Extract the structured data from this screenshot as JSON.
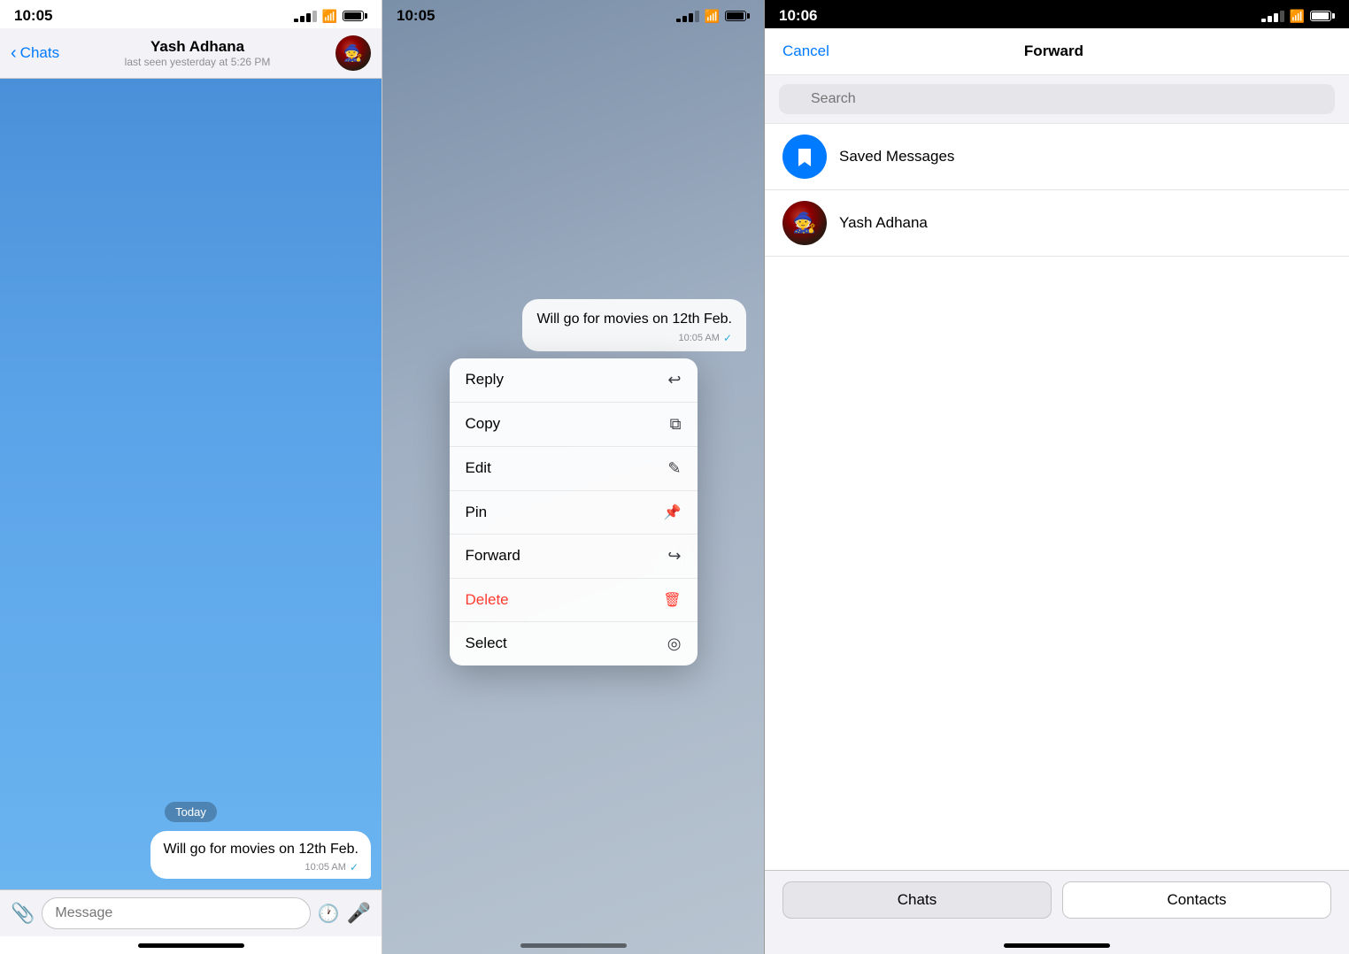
{
  "panel1": {
    "status_time": "10:05",
    "nav_back_label": "Chats",
    "contact_name": "Yash Adhana",
    "contact_status": "last seen yesterday at 5:26 PM",
    "date_badge": "Today",
    "message_text": "Will go for movies on 12th Feb.",
    "message_time": "10:05 AM",
    "input_placeholder": "Message"
  },
  "panel2": {
    "status_time": "10:05",
    "message_text": "Will go for movies on 12th Feb.",
    "message_time": "10:05 AM",
    "menu_items": [
      {
        "label": "Reply",
        "icon": "↩",
        "type": "normal"
      },
      {
        "label": "Copy",
        "icon": "⧉",
        "type": "normal"
      },
      {
        "label": "Edit",
        "icon": "✎",
        "type": "normal"
      },
      {
        "label": "Pin",
        "icon": "📌",
        "type": "normal"
      },
      {
        "label": "Forward",
        "icon": "↪",
        "type": "normal"
      },
      {
        "label": "Delete",
        "icon": "🗑",
        "type": "delete"
      },
      {
        "label": "Select",
        "icon": "◎",
        "type": "normal"
      }
    ]
  },
  "panel3": {
    "status_time": "10:06",
    "cancel_label": "Cancel",
    "title": "Forward",
    "search_placeholder": "Search",
    "contacts": [
      {
        "name": "Saved Messages",
        "type": "saved"
      },
      {
        "name": "Yash Adhana",
        "type": "contact"
      }
    ],
    "tabs": [
      {
        "label": "Chats",
        "active": true
      },
      {
        "label": "Contacts",
        "active": false
      }
    ]
  }
}
